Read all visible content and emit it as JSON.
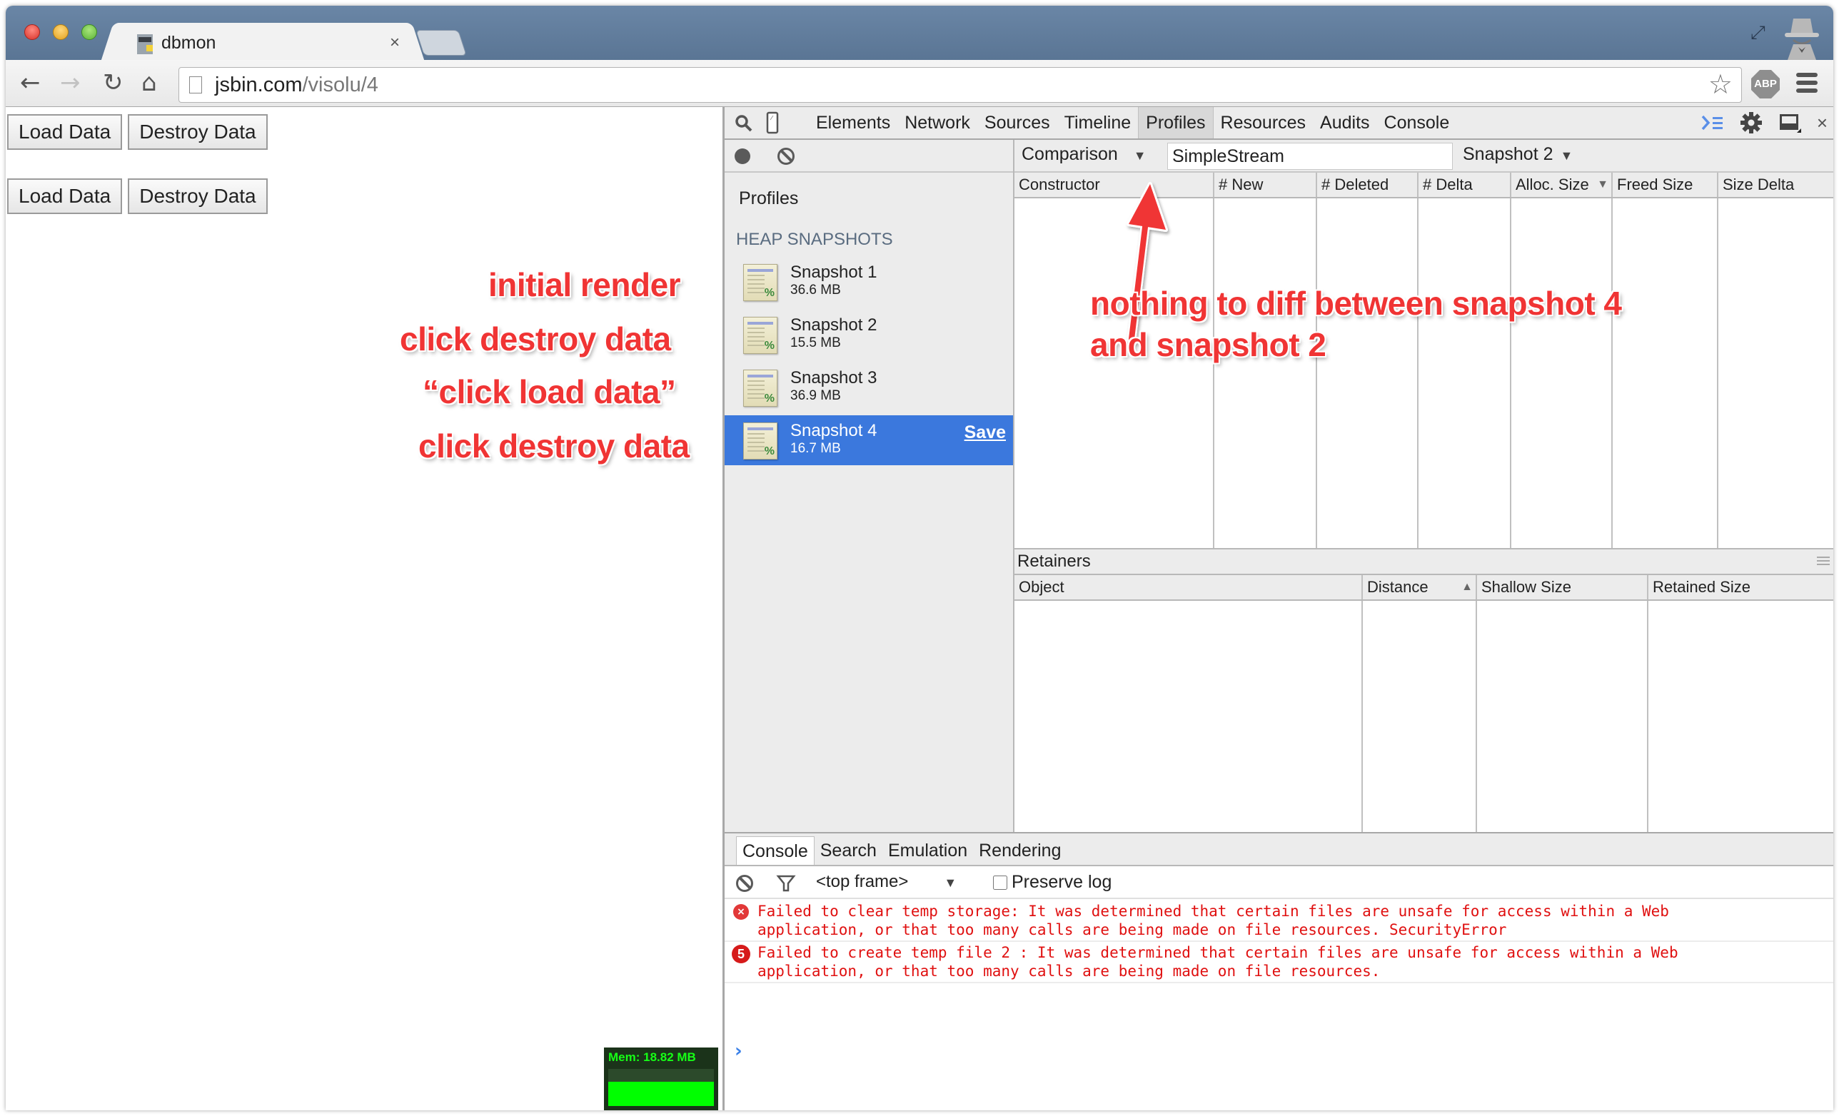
{
  "browser": {
    "tab_title": "dbmon",
    "tab_close": "×",
    "url_host": "jsbin.com",
    "url_path": "/visolu/4",
    "nav": {
      "back": "←",
      "forward": "→",
      "reload": "↻",
      "home": "⌂"
    },
    "star": "☆",
    "abp": "ABP",
    "fullscreen": "⤢"
  },
  "page": {
    "button_rows": [
      {
        "load": "Load Data",
        "destroy": "Destroy Data"
      },
      {
        "load": "Load Data",
        "destroy": "Destroy Data"
      }
    ],
    "annotations": [
      "initial render",
      "click destroy data",
      "“click load data”",
      "click destroy data"
    ],
    "mem_widget": {
      "label": "Mem: 18.82 MB",
      "fill_fraction": 0.65,
      "color": "#00ff00"
    }
  },
  "devtools": {
    "tabs": [
      "Elements",
      "Network",
      "Sources",
      "Timeline",
      "Profiles",
      "Resources",
      "Audits",
      "Console"
    ],
    "active_tab": "Profiles",
    "close": "×",
    "profiles_toolbar": {
      "view": "Comparison",
      "filter_value": "SimpleStream",
      "base_snapshot": "Snapshot 2",
      "arrow": "▼"
    },
    "sidebar": {
      "title": "Profiles",
      "section": "HEAP SNAPSHOTS",
      "snapshots": [
        {
          "name": "Snapshot 1",
          "size": "36.6 MB"
        },
        {
          "name": "Snapshot 2",
          "size": "15.5 MB"
        },
        {
          "name": "Snapshot 3",
          "size": "36.9 MB"
        },
        {
          "name": "Snapshot 4",
          "size": "16.7 MB",
          "selected": true,
          "action": "Save"
        }
      ]
    },
    "comparison_grid": {
      "columns": [
        "Constructor",
        "# New",
        "# Deleted",
        "# Delta",
        "Alloc. Size",
        "Freed Size",
        "Size Delta"
      ],
      "sort_indicator": "▼",
      "rows": []
    },
    "retainers": {
      "title": "Retainers",
      "columns": [
        "Object",
        "Distance",
        "Shallow Size",
        "Retained Size"
      ],
      "sort_indicator": "▲",
      "rows": []
    },
    "drawer": {
      "tabs": [
        "Console",
        "Search",
        "Emulation",
        "Rendering"
      ],
      "active_tab": "Console",
      "frame": "<top frame>",
      "frame_arrow": "▼",
      "preserve_log": "Preserve log",
      "preserve_checked": false,
      "messages": [
        {
          "icon": "×",
          "repeat": null,
          "text": "Failed to clear temp storage: It was determined that certain files are unsafe for access within a Web\napplication, or that too many calls are being made on file resources. SecurityError"
        },
        {
          "icon": null,
          "repeat": "5",
          "text": "Failed to create temp file 2 : It was determined that certain files are unsafe for access within a Web\napplication, or that too many calls are being made on file resources."
        }
      ],
      "prompt": "›"
    },
    "callout": {
      "text_line1": "nothing to diff between snapshot 4",
      "text_line2": "and snapshot 2"
    }
  }
}
